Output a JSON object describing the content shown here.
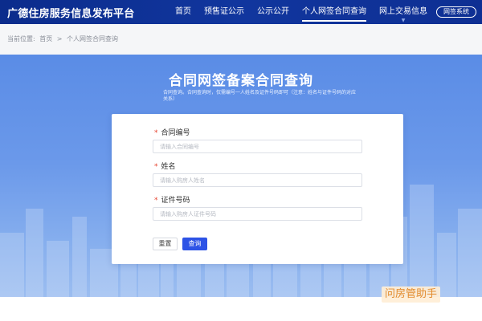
{
  "header": {
    "site_title": "广德住房服务信息发布平台",
    "nav": [
      {
        "label": "首页"
      },
      {
        "label": "预售证公示"
      },
      {
        "label": "公示公开"
      },
      {
        "label": "个人网签合同查询"
      },
      {
        "label": "网上交易信息"
      }
    ],
    "active_nav_index": 3,
    "system_button": "网签系统"
  },
  "breadcrumb": {
    "prefix": "当前位置:",
    "items": [
      "首页",
      ">",
      "个人网签合同查询"
    ]
  },
  "hero": {
    "title": "合同网签备案合同查询",
    "description": "合同查询。合同查询时，仅需编号一人姓名及证件号码即可（注意：姓名与证件号码的对应关系）"
  },
  "form": {
    "fields": [
      {
        "label": "合同编号",
        "required": true,
        "value": "",
        "placeholder": "请输入合同编号"
      },
      {
        "label": "姓名",
        "required": true,
        "value": "",
        "placeholder": "请输入购房人姓名"
      },
      {
        "label": "证件号码",
        "required": true,
        "value": "",
        "placeholder": "请输入购房人证件号码"
      }
    ],
    "required_mark": "*",
    "reset_label": "重置",
    "query_label": "查询"
  },
  "watermark": "问房管助手",
  "colors": {
    "header_bg": "#0e2f93",
    "hero_bg": "#6b99ea",
    "primary_button": "#2d53e6",
    "required_mark": "#e5412d"
  }
}
